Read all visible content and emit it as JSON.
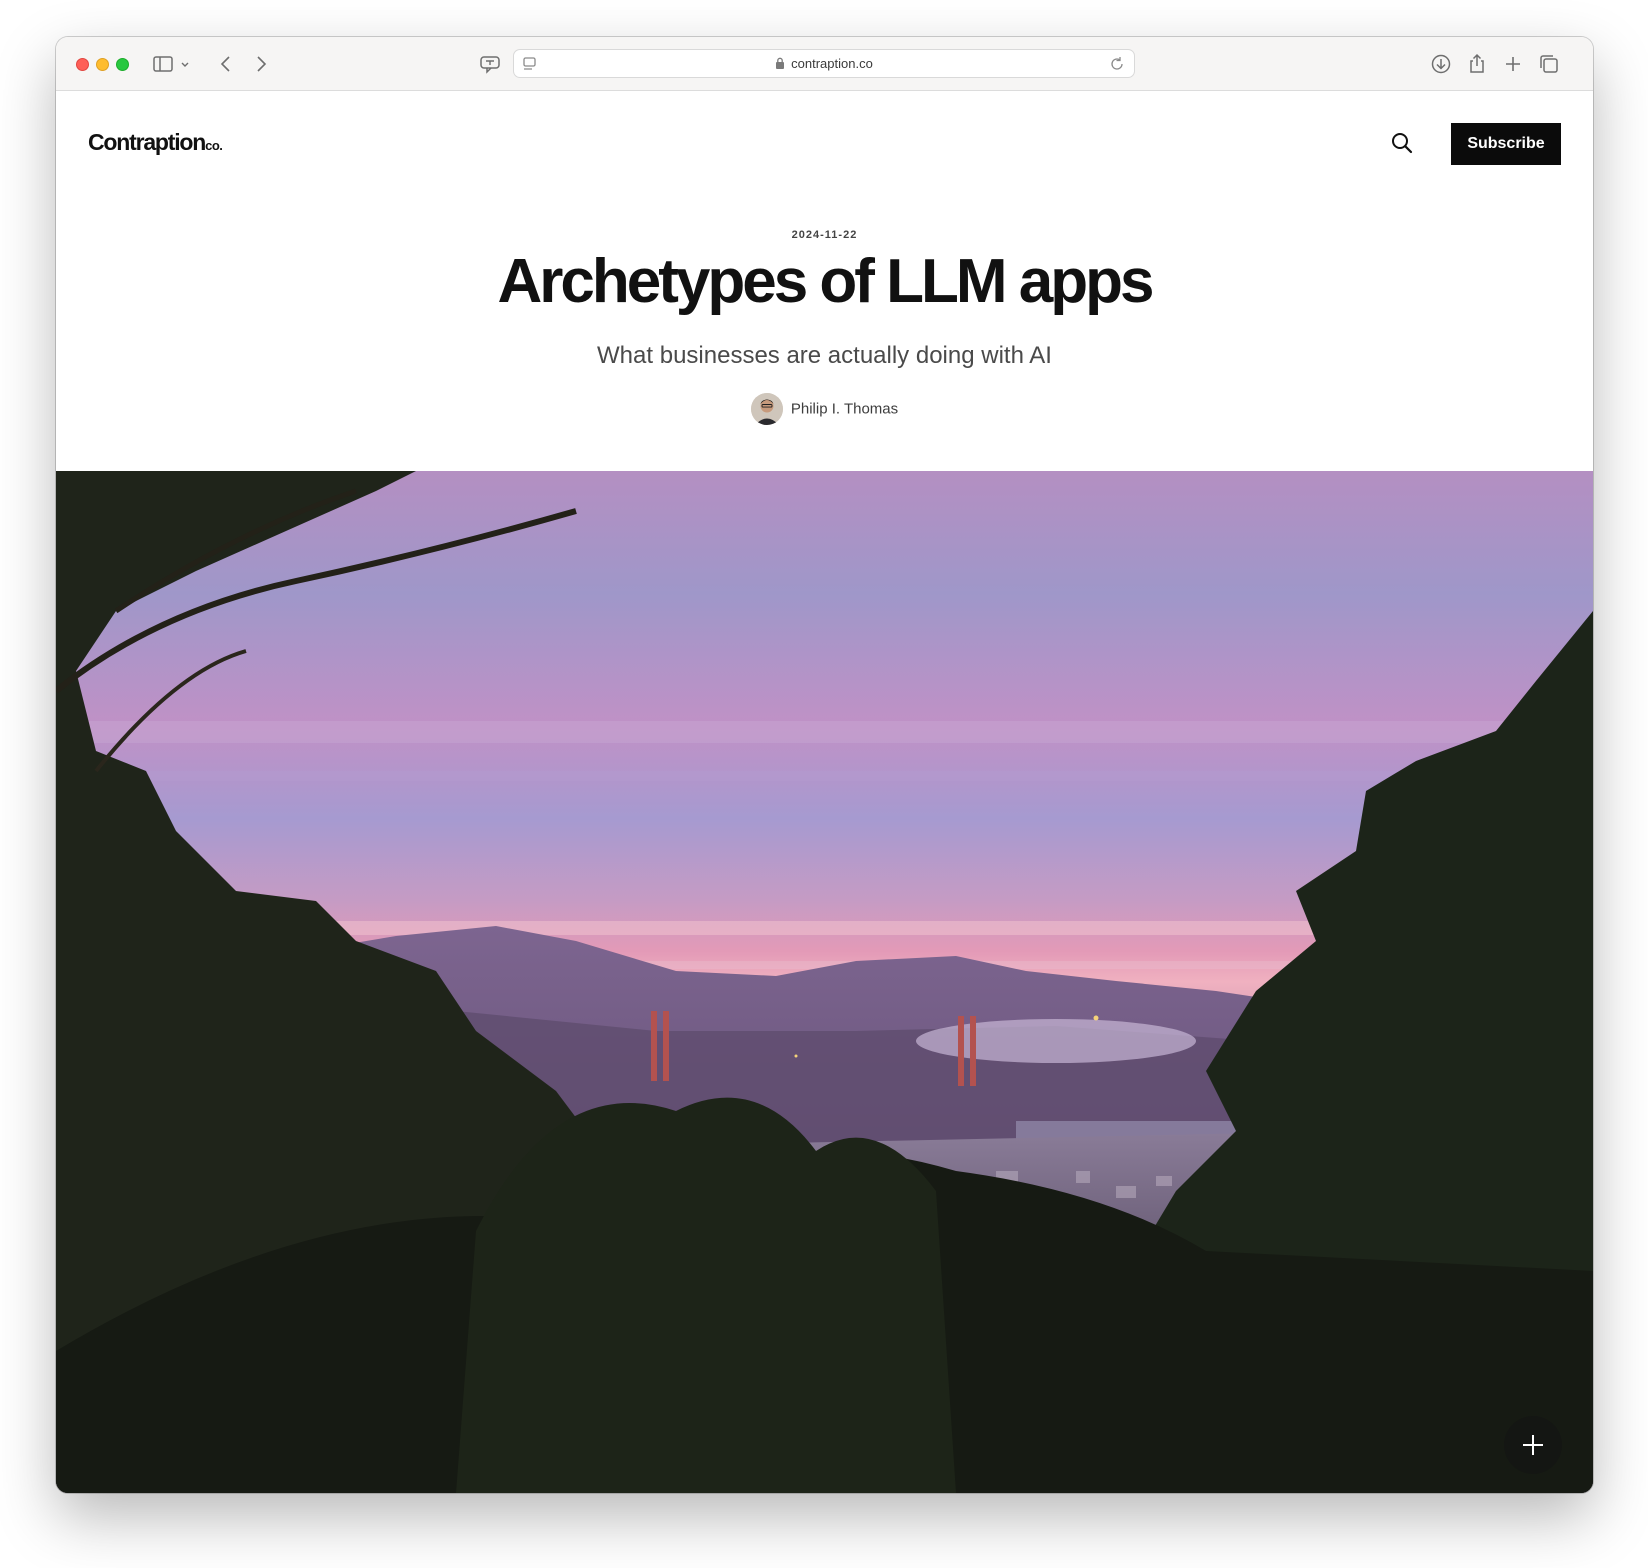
{
  "browser": {
    "url": "contraption.co",
    "icons": {
      "sidebar": "sidebar-icon",
      "back": "chevron-left-icon",
      "forward": "chevron-right-icon",
      "translate": "translate-icon",
      "reader": "reader-icon",
      "lock": "lock-icon",
      "reload": "reload-icon",
      "downloads": "download-icon",
      "share": "share-icon",
      "new_tab": "plus-icon",
      "tabs": "tabs-icon"
    }
  },
  "site": {
    "logo_main": "Contraption",
    "logo_suffix": "co.",
    "subscribe_label": "Subscribe"
  },
  "article": {
    "date": "2024-11-22",
    "title": "Archetypes of LLM apps",
    "subtitle": "What businesses are actually doing with AI",
    "author": "Philip I. Thomas"
  },
  "colors": {
    "subscribe_bg": "#0b0b0b",
    "sky_top": "#a89cc8",
    "sky_pink": "#e9a4c0",
    "tree_dark": "#1f241a"
  }
}
